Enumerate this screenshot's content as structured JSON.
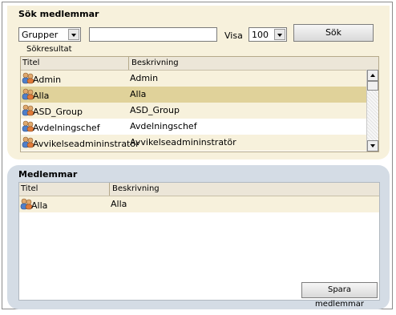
{
  "search": {
    "title": "Sök medlemmar",
    "filter_value": "Grupper",
    "query_value": "",
    "visa_label": "Visa",
    "visa_value": "100",
    "search_button": "Sök",
    "results_label": "Sökresultat",
    "columns": [
      "Titel",
      "Beskrivning"
    ],
    "rows": [
      {
        "title": "Admin",
        "description": "Admin",
        "bg": "#f7f1dc"
      },
      {
        "title": "Alla",
        "description": "Alla",
        "bg": "#e0d29a"
      },
      {
        "title": "ASD_Group",
        "description": "ASD_Group",
        "bg": "#f7f1dc"
      },
      {
        "title": "Avdelningschef",
        "description": "Avdelningschef",
        "bg": "#ffffff"
      },
      {
        "title": "Avvikelseadmininstratör",
        "description": "Avvikelseadmininstratör",
        "bg": "#f7f1dc"
      }
    ],
    "scroll_fraction": 0.0
  },
  "members": {
    "title": "Medlemmar",
    "columns": [
      "Titel",
      "Beskrivning"
    ],
    "rows": [
      {
        "title": "Alla",
        "description": "Alla"
      }
    ],
    "save_button": "Spara medlemmar"
  },
  "icons": {
    "group": "group-icon"
  }
}
